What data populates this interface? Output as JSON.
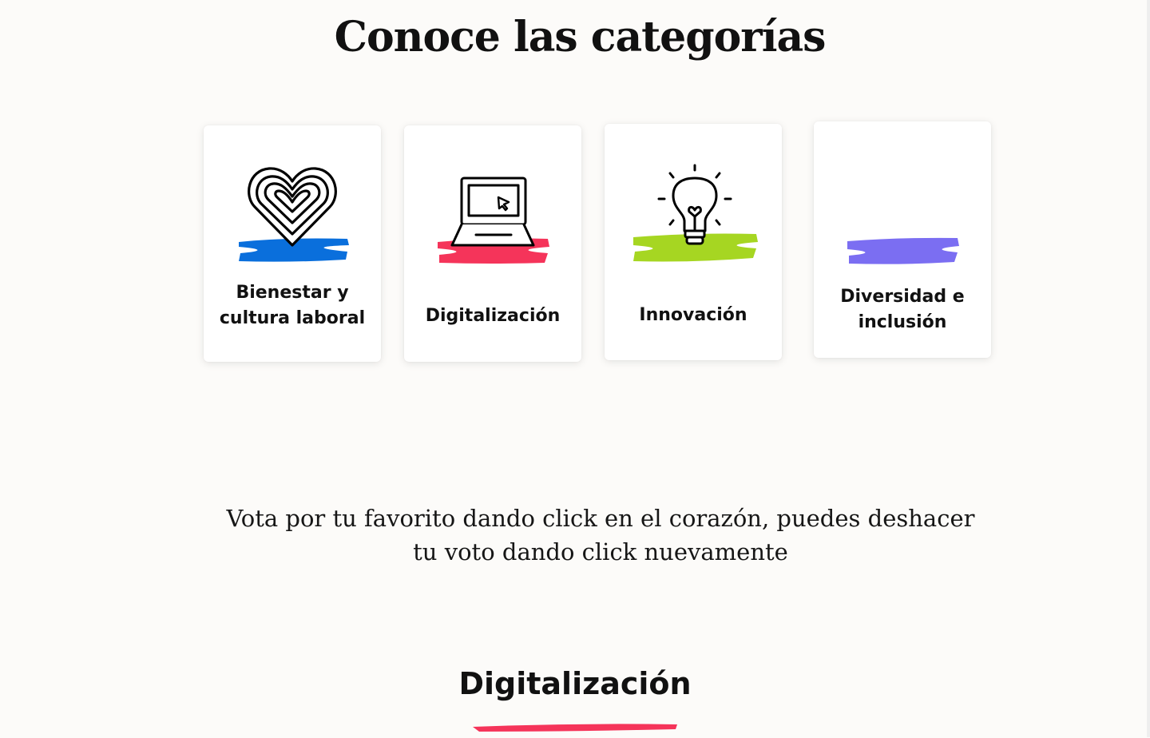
{
  "page": {
    "title": "Conoce las categorías",
    "instructions": "Vota por tu favorito dando click en el corazón, puedes deshacer tu voto dando click nuevamente",
    "section_title": "Digitalización"
  },
  "categories": [
    {
      "label_line1": "Bienestar y",
      "label_line2": "cultura laboral",
      "icon": "heart-icon",
      "accent": "#0a6fdc"
    },
    {
      "label": "Digitalización",
      "icon": "laptop-icon",
      "accent": "#f5345a"
    },
    {
      "label": "Innovación",
      "icon": "lightbulb-icon",
      "accent": "#a6d622"
    },
    {
      "label_line1": "Diversidad e",
      "label_line2": "inclusión",
      "icon": "diversity-icon",
      "accent": "#7b6ef2"
    }
  ],
  "section": {
    "underline_color": "#f5345a"
  }
}
